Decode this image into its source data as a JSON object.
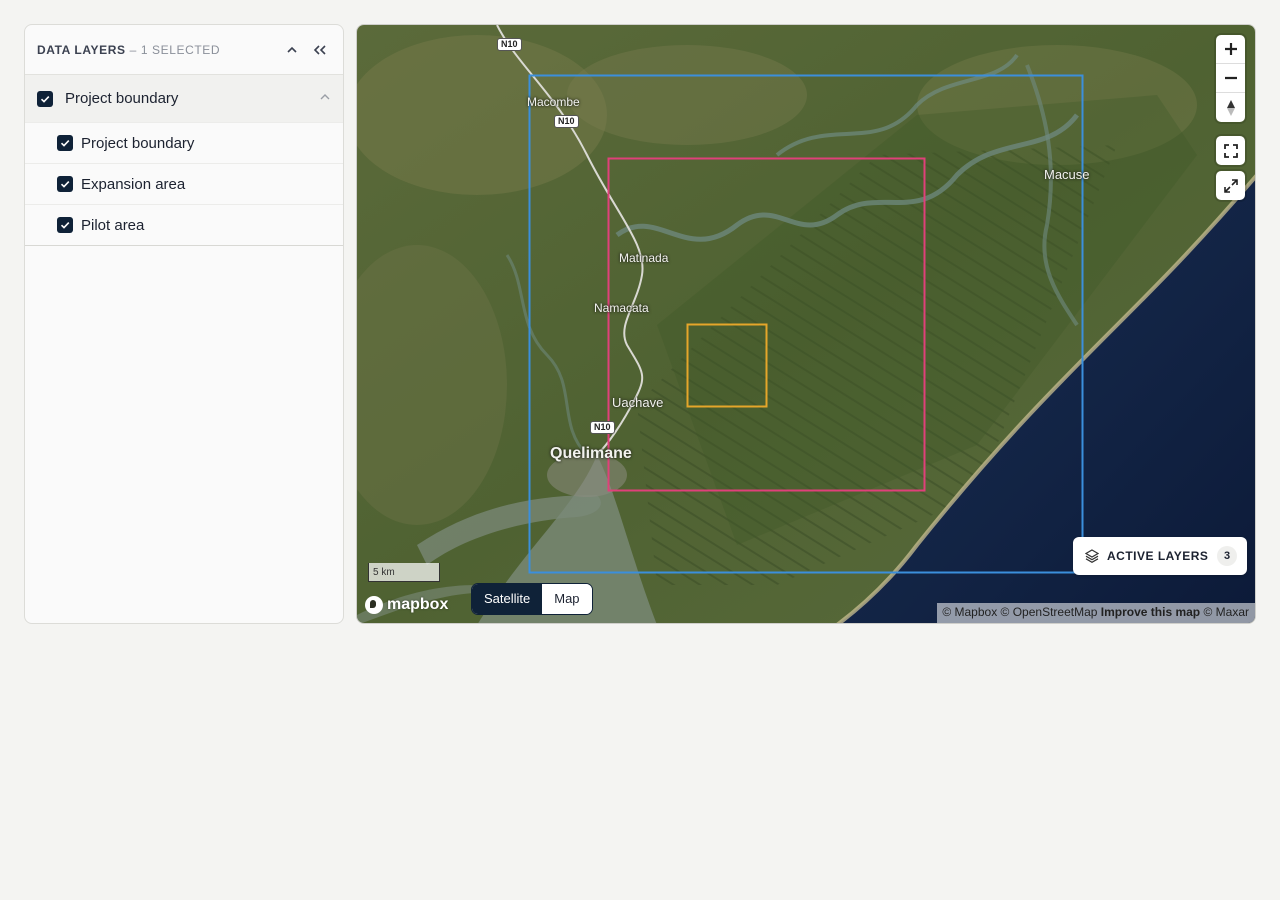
{
  "panel": {
    "title": "Data layers",
    "subtitle": "– 1 selected",
    "group": {
      "label": "Project boundary",
      "checked": true
    },
    "items": [
      {
        "label": "Project boundary",
        "checked": true
      },
      {
        "label": "Expansion area",
        "checked": true
      },
      {
        "label": "Pilot area",
        "checked": true
      }
    ]
  },
  "map": {
    "places": {
      "macombe": "Macombe",
      "macuse": "Macuse",
      "matinada": "Matinada",
      "namacata": "Namacata",
      "uachave": "Uachave",
      "quelimane": "Quelimane"
    },
    "road_label": "N10",
    "scale_label": "5 km",
    "logo_text": "mapbox",
    "style_toggle": {
      "satellite": "Satellite",
      "map": "Map",
      "selected": "Satellite"
    },
    "active_layers": {
      "label": "Active layers",
      "count": "3"
    },
    "attribution": {
      "mapbox": "© Mapbox",
      "osm": "© OpenStreetMap",
      "improve": "Improve this map",
      "maxar": "© Maxar"
    },
    "layer_colors": {
      "project_boundary": "#3b8fdc",
      "expansion_area": "#e0407a",
      "pilot_area": "#e5a62a"
    },
    "icons": [
      "zoom-in-icon",
      "zoom-out-icon",
      "compass-icon",
      "fullscreen-icon",
      "expand-icon",
      "layers-icon"
    ]
  }
}
